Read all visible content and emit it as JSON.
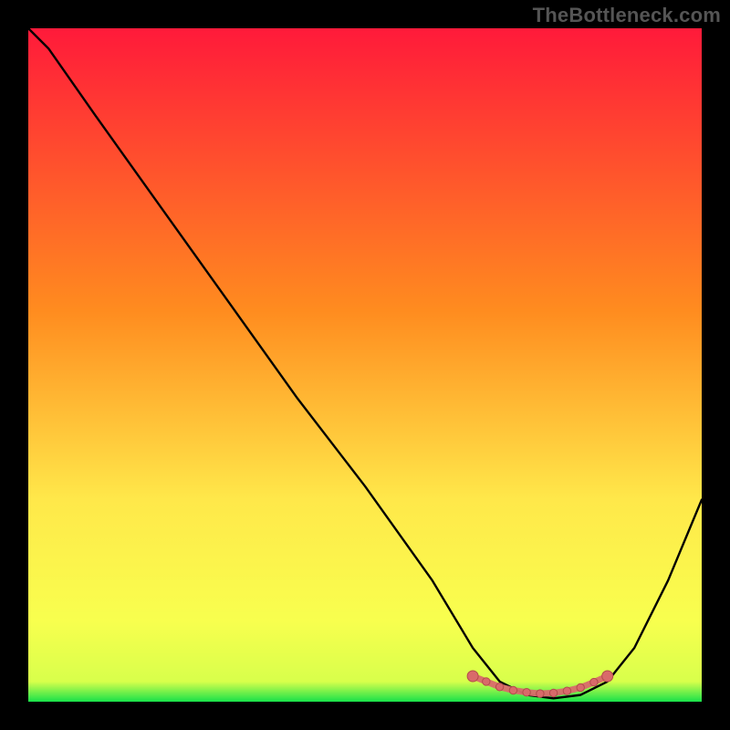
{
  "attribution": "TheBottleneck.com",
  "colors": {
    "frame": "#000000",
    "gradient_top": "#ff1a3a",
    "gradient_mid": "#ffb200",
    "gradient_low": "#ffe84a",
    "gradient_yellow2": "#f8ff4e",
    "gradient_bottom": "#18e24a",
    "curve": "#000000",
    "marker_fill": "#d96a6a",
    "marker_stroke": "#b34b4b"
  },
  "chart_data": {
    "type": "line",
    "title": "",
    "xlabel": "",
    "ylabel": "",
    "xlim": [
      0,
      100
    ],
    "ylim": [
      0,
      100
    ],
    "grid": false,
    "legend": false,
    "series": [
      {
        "name": "bottleneck-curve",
        "x": [
          0,
          3,
          10,
          20,
          30,
          40,
          50,
          60,
          66,
          70,
          74,
          78,
          82,
          86,
          90,
          95,
          100
        ],
        "y": [
          100,
          97,
          87,
          73,
          59,
          45,
          32,
          18,
          8,
          3,
          1,
          0.5,
          1,
          3,
          8,
          18,
          30
        ]
      }
    ],
    "markers": {
      "name": "optimal-range",
      "x": [
        66,
        68,
        70,
        72,
        74,
        76,
        78,
        80,
        82,
        84,
        86
      ],
      "y": [
        3.8,
        3.0,
        2.2,
        1.7,
        1.4,
        1.2,
        1.3,
        1.6,
        2.1,
        2.9,
        3.8
      ]
    }
  }
}
